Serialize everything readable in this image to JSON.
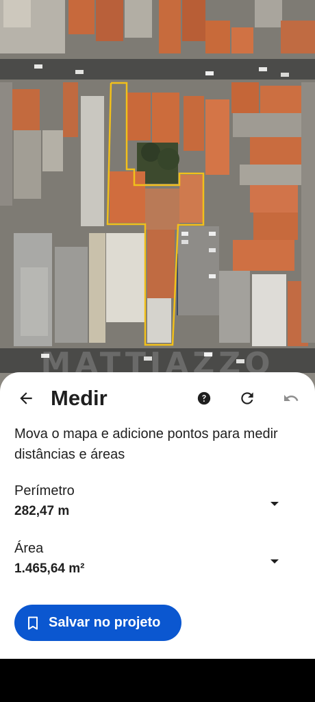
{
  "map": {
    "watermark": "MATTIAZZO",
    "colors": {
      "outline": "#f2c01a",
      "roof": "#c8683a",
      "road": "#4a4a48",
      "concrete": "#9a9890"
    }
  },
  "sheet": {
    "title": "Medir",
    "back_icon": "arrow-left-icon",
    "help_icon": "help-circle-icon",
    "reset_icon": "refresh-icon",
    "undo_icon": "undo-icon",
    "instructions": "Mova o mapa e adicione pontos para medir distâncias e áreas",
    "perimeter": {
      "label": "Perímetro",
      "value": "282,47 m"
    },
    "area": {
      "label": "Área",
      "value": "1.465,64 m²"
    },
    "save_button": {
      "label": "Salvar no projeto",
      "icon": "bookmark-icon"
    }
  },
  "colors": {
    "accent": "#0b57d0",
    "text": "#1f1f1f",
    "disabled_icon": "#8e8e8e"
  }
}
